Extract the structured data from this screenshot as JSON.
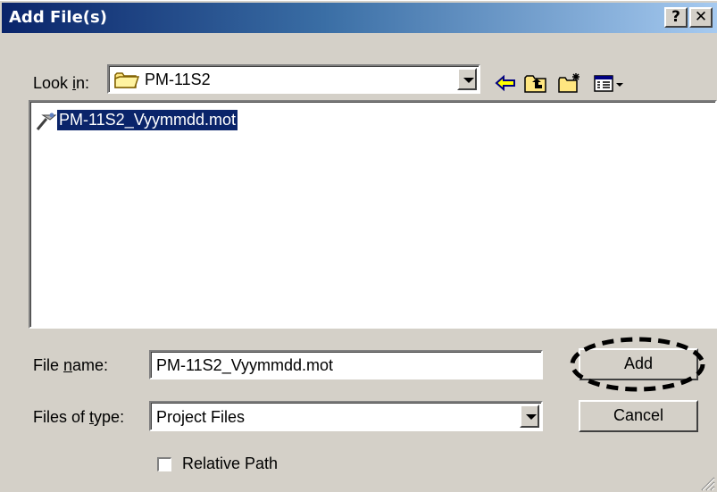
{
  "window": {
    "title": "Add File(s)",
    "help_label": "?",
    "close_label": "✕"
  },
  "look_in": {
    "label_pre": "Look ",
    "label_hotkey": "i",
    "label_post": "n:",
    "value": "PM-11S2",
    "icon": "folder-icon"
  },
  "toolbar": {
    "icons": [
      "back-arrow-icon",
      "up-one-level-icon",
      "new-folder-icon",
      "view-menu-icon"
    ]
  },
  "file_list": {
    "items": [
      {
        "name": "PM-11S2_Vyymmdd.mot",
        "icon": "mot-file-icon",
        "selected": true
      }
    ]
  },
  "file_name": {
    "label_pre": "File ",
    "label_hotkey": "n",
    "label_post": "ame:",
    "value": "PM-11S2_Vyymmdd.mot"
  },
  "files_of_type": {
    "label_pre": "Files of ",
    "label_hotkey": "t",
    "label_post": "ype:",
    "value": "Project Files"
  },
  "buttons": {
    "add_label": "Add",
    "cancel_label": "Cancel"
  },
  "relative_path": {
    "label": "Relative Path",
    "checked": false
  },
  "colors": {
    "title_start": "#0a246a",
    "title_end": "#a6caf0",
    "face": "#d4d0c8",
    "selection": "#0a246a"
  }
}
